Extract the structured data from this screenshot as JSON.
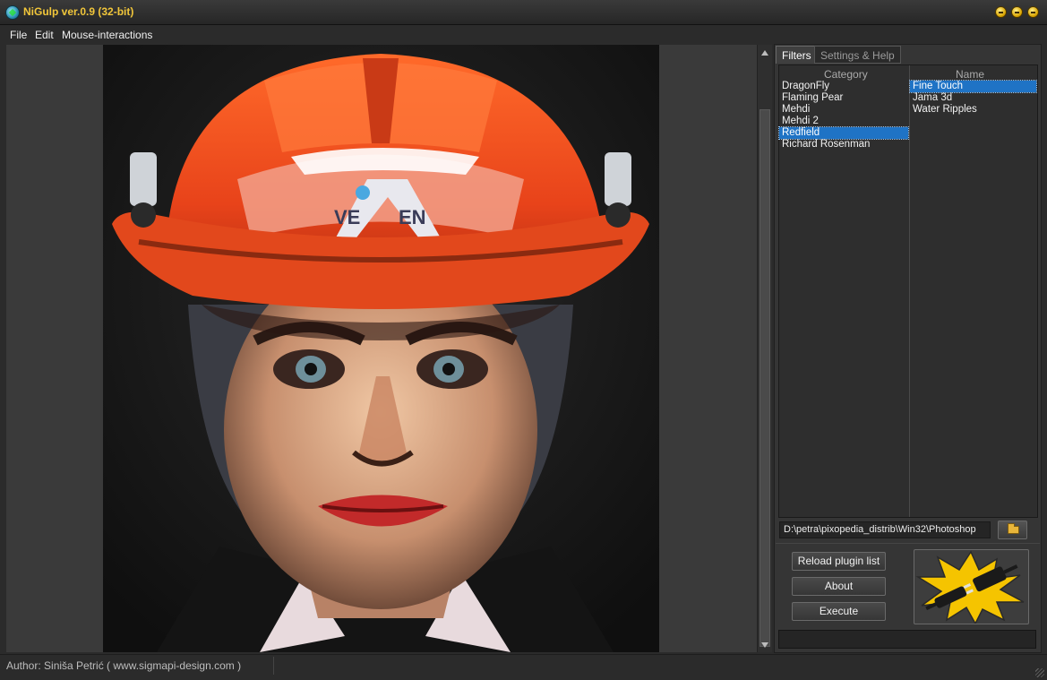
{
  "window": {
    "title": "NiGulp ver.0.9 (32-bit)",
    "icon": "app-icon",
    "controls": [
      "minimize",
      "maximize",
      "close"
    ]
  },
  "menu": {
    "items": [
      "File",
      "Edit",
      "Mouse-interactions"
    ]
  },
  "canvas": {
    "content": "filtered portrait of woman in orange safety helmet"
  },
  "panel": {
    "tabs": [
      {
        "label": "Filters",
        "active": true
      },
      {
        "label": "Settings & Help",
        "active": false
      }
    ],
    "category_header": "Category",
    "name_header": "Name",
    "categories": [
      "DragonFly",
      "Flaming Pear",
      "Mehdi",
      "Mehdi 2",
      "Redfield",
      "Richard Rosenman"
    ],
    "selected_category": "Redfield",
    "names": [
      "Fine Touch",
      "Jama 3d",
      "Water Ripples"
    ],
    "selected_name": "Fine Touch",
    "plugin_path": "D:\\petra\\pixopedia_distrib\\Win32\\Photoshop",
    "buttons": {
      "reload": "Reload plugin list",
      "about": "About",
      "execute": "Execute"
    }
  },
  "status": {
    "author": "Author:  Siniša Petrić ( www.sigmapi-design.com )"
  },
  "colors": {
    "title_text": "#f1c63a",
    "selection": "#1f73c5",
    "background": "#2b2b2b"
  }
}
